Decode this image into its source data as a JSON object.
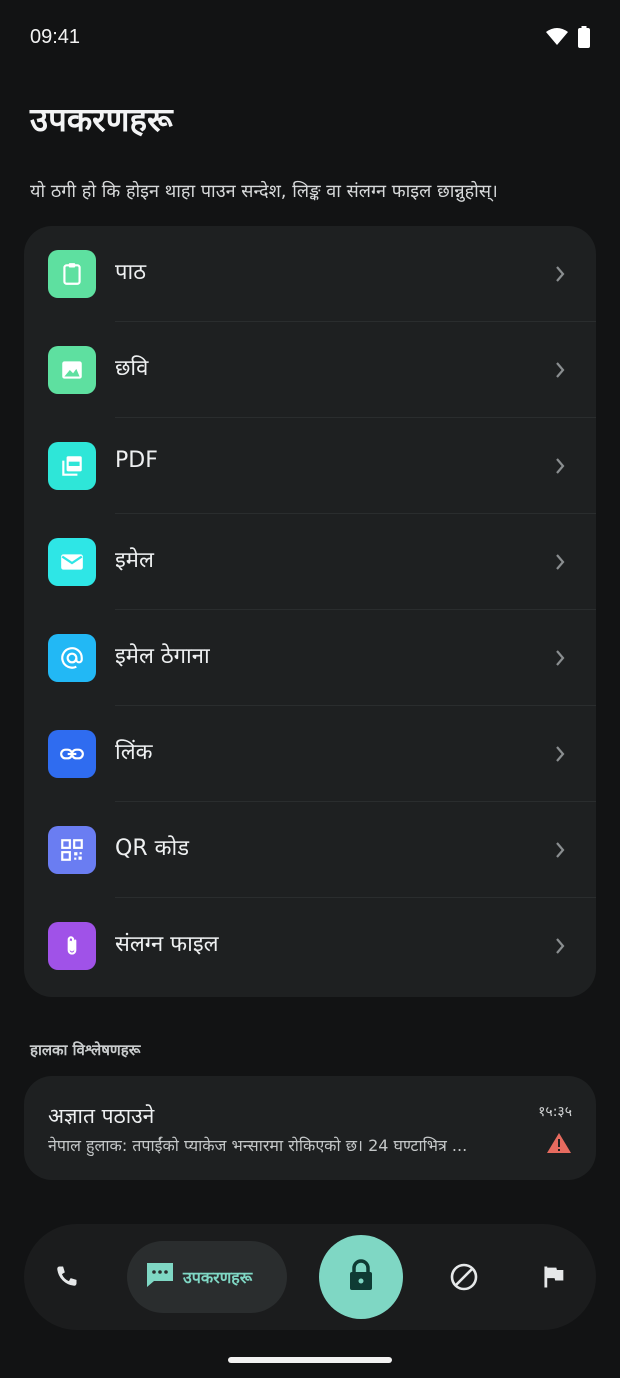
{
  "status_bar": {
    "time": "09:41"
  },
  "page": {
    "title": "उपकरणहरू",
    "subtitle": "यो ठगी हो कि होइन थाहा पाउन सन्देश, लिङ्क वा संलग्न फाइल छान्नुहोस्।"
  },
  "tools": [
    {
      "label": "पाठ",
      "icon": "clipboard-icon",
      "color": "#5ee0a0"
    },
    {
      "label": "छवि",
      "icon": "image-icon",
      "color": "#5ee0a0"
    },
    {
      "label": "PDF",
      "icon": "pdf-icon",
      "color": "#2ee6d8"
    },
    {
      "label": "इमेल",
      "icon": "mail-icon",
      "color": "#2ee6e6"
    },
    {
      "label": "इमेल ठेगाना",
      "icon": "at-sign-icon",
      "color": "#22b8f5"
    },
    {
      "label": "लिंक",
      "icon": "link-icon",
      "color": "#2f6cf0"
    },
    {
      "label": "QR कोड",
      "icon": "qr-code-icon",
      "color": "#6a7df2"
    },
    {
      "label": "संलग्न फाइल",
      "icon": "paperclip-icon",
      "color": "#a052e8"
    }
  ],
  "recent": {
    "section_label": "हालका विश्लेषणहरू",
    "items": [
      {
        "sender": "अज्ञात पठाउने",
        "snippet": "नेपाल हुलाक: तपाईंको प्याकेज भन्सारमा रोकिएको छ। 24 घण्टाभित्र ...",
        "time": "१५:३५",
        "status_icon": "warning-icon",
        "status_color": "#e66b5f"
      }
    ]
  },
  "nav": {
    "tools_label": "उपकरणहरू",
    "accent": "#7fd7c4"
  }
}
